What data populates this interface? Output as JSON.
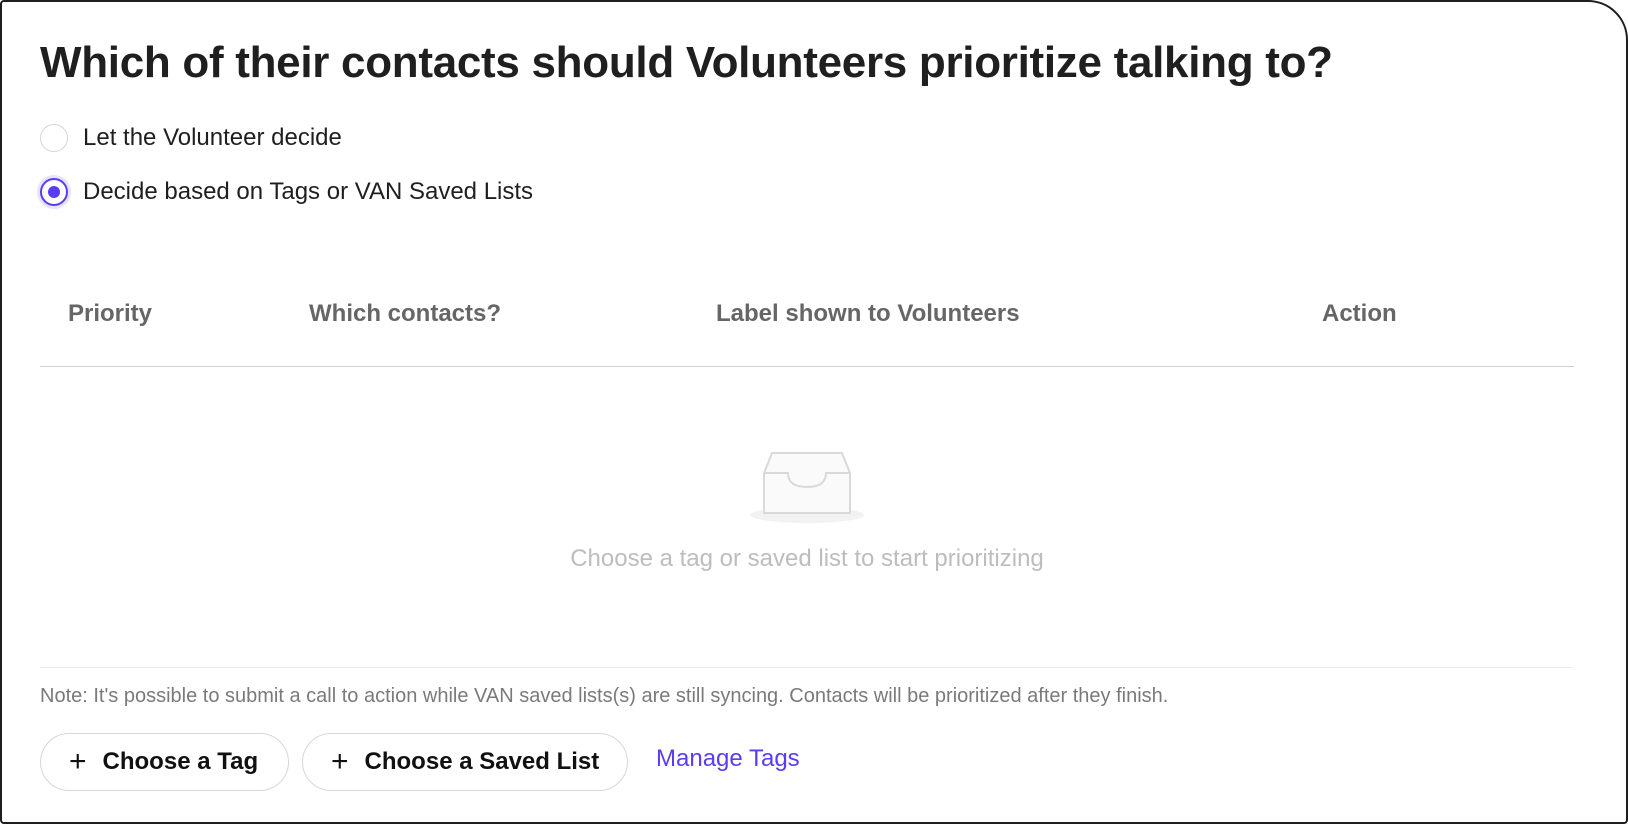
{
  "page": {
    "title": "Which of their contacts should Volunteers prioritize talking to?"
  },
  "options": [
    {
      "label": "Let the Volunteer decide",
      "selected": false
    },
    {
      "label": "Decide based on Tags or VAN Saved Lists",
      "selected": true
    }
  ],
  "table": {
    "columns": [
      "Priority",
      "Which contacts?",
      "Label shown to Volunteers",
      "Action"
    ],
    "rows": [],
    "empty_icon": "inbox-icon",
    "empty_text": "Choose a tag or saved list to start prioritizing"
  },
  "note": "Note: It's possible to submit a call to action while VAN saved lists(s) are still syncing. Contacts will be prioritized after they finish.",
  "actions": {
    "choose_tag_label": "Choose a Tag",
    "choose_saved_list_label": "Choose a Saved List",
    "plus_icon": "plus-icon",
    "manage_tags_label": "Manage Tags"
  },
  "colors": {
    "accent": "#5b3cf5",
    "border": "#1e1e1e",
    "muted_text": "#bdbdbd"
  }
}
